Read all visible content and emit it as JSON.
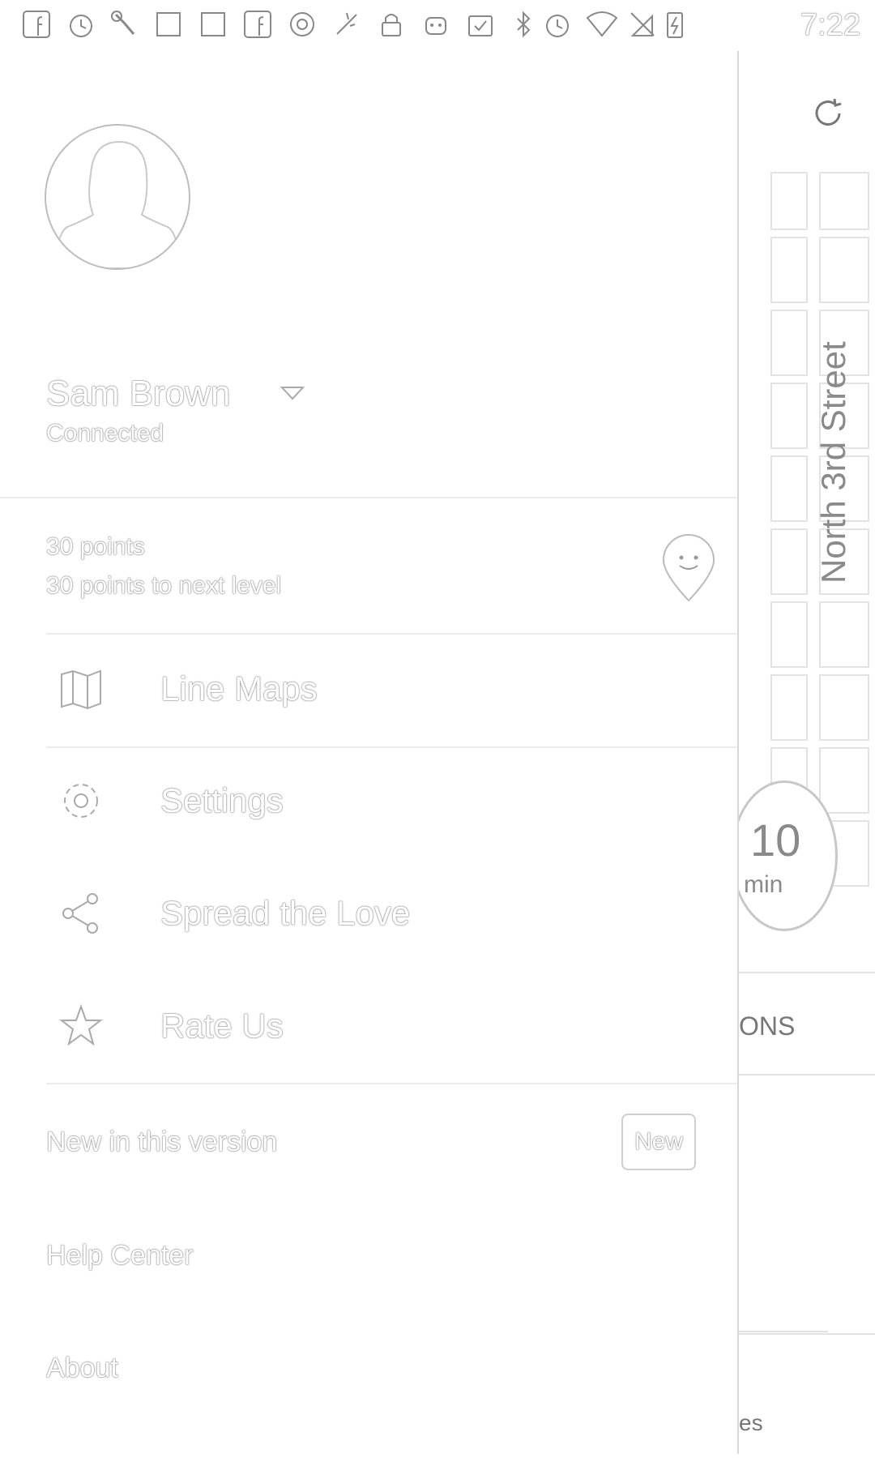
{
  "status_bar": {
    "time": "7:22",
    "icons": [
      "facebook-icon",
      "alarm-icon",
      "wrench-icon",
      "puzzle-icon",
      "puzzle-icon",
      "facebook-icon",
      "circle-icon",
      "sparkle-icon",
      "lock-icon",
      "android-icon",
      "clipboard-check-icon",
      "bluetooth-icon",
      "alarm-icon",
      "wifi-icon",
      "no-sim-icon",
      "battery-charging-icon"
    ]
  },
  "drawer": {
    "profile": {
      "name": "Sam Brown",
      "status": "Connected"
    },
    "points": {
      "total": "30 points",
      "to_next": "30 points to next level"
    },
    "menu": [
      {
        "label": "Line Maps",
        "icon": "map-icon"
      },
      {
        "label": "Settings",
        "icon": "gear-icon"
      },
      {
        "label": "Spread the Love",
        "icon": "share-icon"
      },
      {
        "label": "Rate Us",
        "icon": "star-icon"
      }
    ],
    "links": {
      "whats_new": "New in this version",
      "new_badge": "New",
      "help": "Help Center",
      "about": "About"
    }
  },
  "background": {
    "street_label": "North 3rd Street",
    "eta_value": "10",
    "eta_unit": "min",
    "tab_fragment": "ONS",
    "bottom_fragment": "es"
  }
}
